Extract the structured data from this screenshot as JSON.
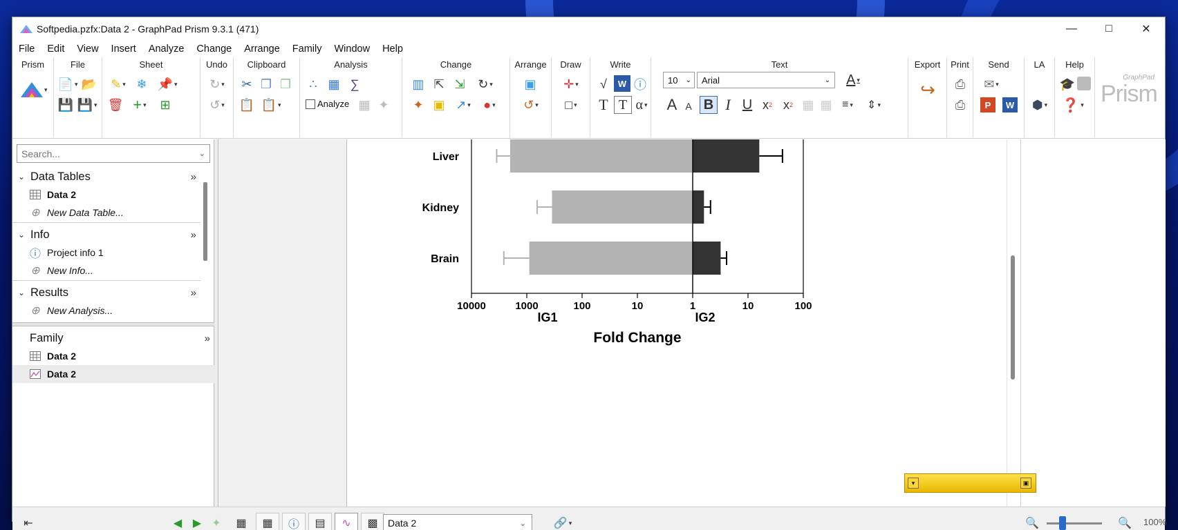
{
  "window": {
    "title": "Softpedia.pzfx:Data 2 - GraphPad Prism 9.3.1 (471)"
  },
  "menu": [
    "File",
    "Edit",
    "View",
    "Insert",
    "Analyze",
    "Change",
    "Arrange",
    "Family",
    "Window",
    "Help"
  ],
  "ribbon": {
    "groups": {
      "prism": "Prism",
      "file": "File",
      "sheet": "Sheet",
      "undo": "Undo",
      "clipboard": "Clipboard",
      "analysis": "Analysis",
      "change": "Change",
      "arrange": "Arrange",
      "draw": "Draw",
      "write": "Write",
      "text": "Text",
      "export": "Export",
      "print": "Print",
      "send": "Send",
      "la": "LA",
      "help": "Help"
    },
    "analyze_label": "Analyze",
    "font_size": "10",
    "font_name": "Arial",
    "brand": "Prism",
    "brand_small": "GraphPad"
  },
  "navigator": {
    "search_placeholder": "Search...",
    "data_tables": {
      "label": "Data Tables",
      "items": [
        "Data 2"
      ],
      "new_label": "New Data Table..."
    },
    "info": {
      "label": "Info",
      "items": [
        "Project info 1"
      ],
      "new_label": "New Info..."
    },
    "results": {
      "label": "Results",
      "new_label": "New Analysis..."
    },
    "family": {
      "label": "Family",
      "items": [
        "Data 2",
        "Data 2"
      ]
    }
  },
  "bottom": {
    "sheet_select": "Data 2",
    "zoom": "100%"
  },
  "chart_data": {
    "type": "bar",
    "orientation": "horizontal",
    "categories": [
      "Liver",
      "Kidney",
      "Brain"
    ],
    "series": [
      {
        "name": "IG1",
        "values": [
          2000,
          350,
          900
        ],
        "error_ends": [
          3500,
          650,
          2600
        ],
        "color": "#b3b3b3"
      },
      {
        "name": "IG2",
        "values": [
          16,
          1.6,
          3.2
        ],
        "error_ends": [
          42,
          2.1,
          4.1
        ],
        "color": "#333333"
      }
    ],
    "x_ticks": [
      "10000",
      "1000",
      "100",
      "10",
      "1",
      "10",
      "100"
    ],
    "x_scale": "log",
    "xlabel": "Fold Change",
    "group_labels": [
      "IG1",
      "IG2"
    ]
  }
}
